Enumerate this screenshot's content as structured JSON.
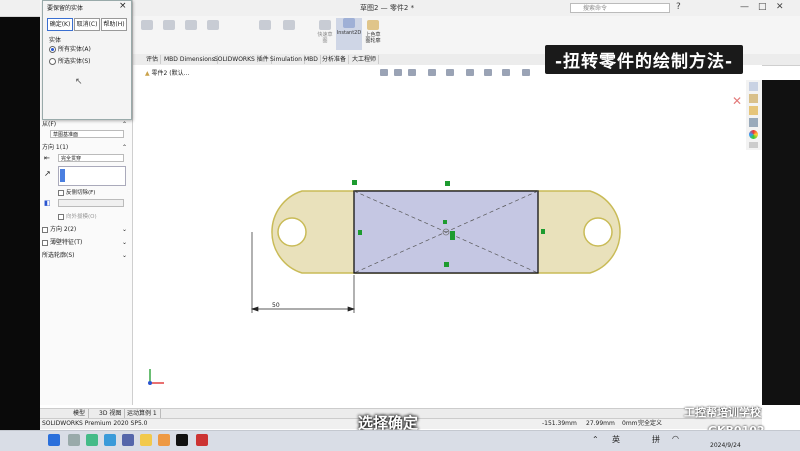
{
  "window": {
    "title": "草图2 — 零件2 *",
    "search_placeholder": "搜索命令"
  },
  "ribbon": {
    "quick_snap": "快速草图",
    "instant2d": "Instant2D",
    "color_sketch": "上色草图轮廓"
  },
  "tabs": [
    "评估",
    "MBD Dimensions",
    "SOLIDWORKS 插件",
    "Simulation",
    "MBD",
    "分析准备",
    "大工程师"
  ],
  "dialog": {
    "title": "要保留的实体",
    "ok": "确定(K)",
    "cancel": "取消(C)",
    "help": "帮助(H)",
    "group": "实体",
    "option_all": "所有实体(A)",
    "option_selected": "所选实体(S)"
  },
  "feature_panel": {
    "from_label": "从(F)",
    "from_value": "草图基准面",
    "dir1_label": "方向 1(1)",
    "dir1_value": "完全贯穿",
    "reverse_cut": "反侧切除(F)",
    "draft_outward": "向外拔模(O)",
    "dir2_label": "方向 2(2)",
    "thin_feature": "薄壁特征(T)",
    "selected_contours": "所选轮廓(S)"
  },
  "tree": {
    "part_name": "零件2 (默认..."
  },
  "drawing": {
    "dimension": "50"
  },
  "overlay_title": "-扭转零件的绘制方法-",
  "subtitle": "选择确定",
  "watermark": {
    "line1": "工控帮培训学校",
    "line2": "GKB0102"
  },
  "bottom_tabs": [
    "模型",
    "3D 视图",
    "运动算例 1"
  ],
  "status": {
    "product": "SOLIDWORKS Premium 2020 SP5.0",
    "x": "-151.39mm",
    "y": "27.99mm",
    "z": "0mm",
    "state": "完全定义"
  },
  "taskbar": {
    "lang": "英",
    "ime": "拼",
    "time": "2024/9/24"
  },
  "colors": {
    "part_fill": "#e9e1bb",
    "part_outline": "#c9bb57",
    "selected_fill": "#c5c7e3",
    "handle": "#1d9b2f",
    "overlay_bg": "#1a1a1a"
  }
}
